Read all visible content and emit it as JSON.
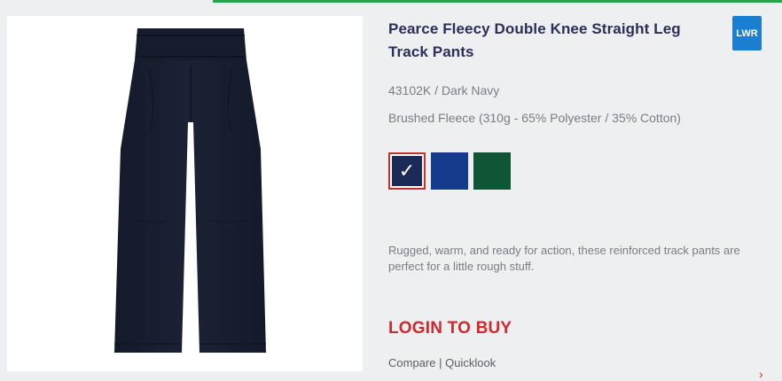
{
  "product": {
    "title": "Pearce Fleecy Double Knee Straight Leg Track Pants",
    "brand_badge": "LWR",
    "sku_colour": "43102K / Dark Navy",
    "fabric": "Brushed Fleece (310g - 65% Polyester / 35% Cotton)",
    "description": "Rugged, warm, and ready for action, these reinforced track pants are perfect for a little rough stuff.",
    "image_icon": "track-pants-image"
  },
  "swatches": [
    {
      "name": "Dark Navy",
      "color": "#1b2a56",
      "selected": true,
      "check": "✓"
    },
    {
      "name": "Royal Blue",
      "color": "#173b8c",
      "selected": false
    },
    {
      "name": "Bottle Green",
      "color": "#0f5536",
      "selected": false
    }
  ],
  "actions": {
    "login_label": "LOGIN TO BUY",
    "compare_label": "Compare",
    "separator": "|",
    "quicklook_label": "Quicklook",
    "arrow_icon": "chevron-right-icon"
  },
  "colors": {
    "accent_green": "#2f9e44",
    "title_navy": "#2b2f5a",
    "login_red": "#d1282e",
    "badge_blue": "#1a7fd1"
  }
}
